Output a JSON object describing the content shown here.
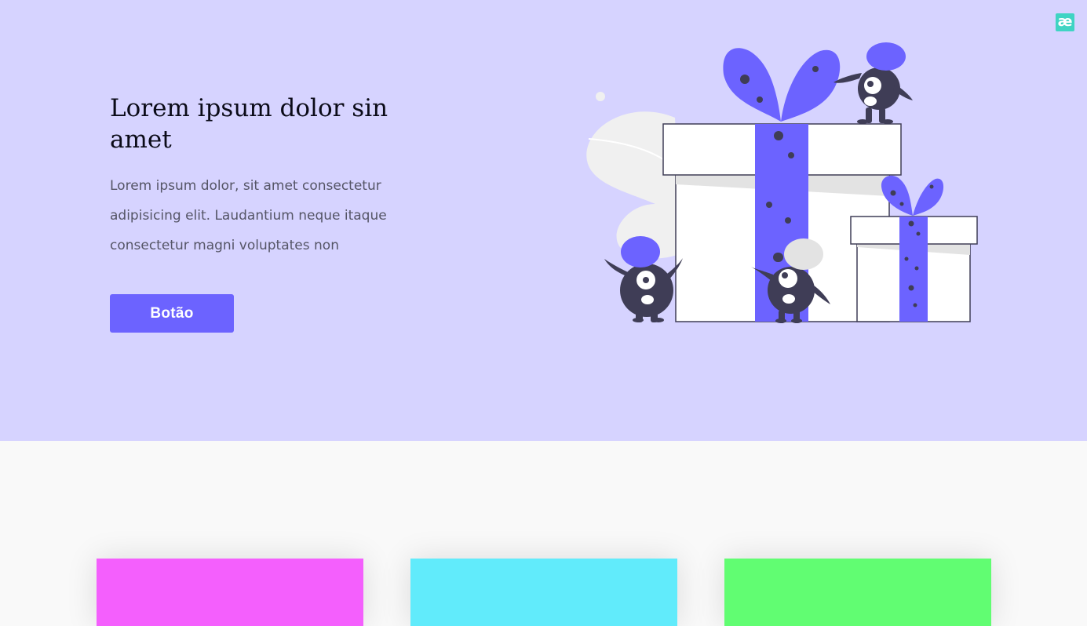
{
  "hero": {
    "title": "Lorem ipsum dolor sin amet",
    "body": "Lorem ipsum dolor, sit amet consectetur adipisicing elit. Laudantium neque itaque consectetur magni voluptates non",
    "button_label": "Botão",
    "illustration_icon": "gift-boxes-with-monsters-illustration",
    "colors": {
      "background": "#d6d3ff",
      "accent": "#6c63ff",
      "dark": "#2f2e41"
    }
  },
  "logo": {
    "glyph": "æ",
    "icon": "brand-logo-icon",
    "color": "#3fd4c3"
  },
  "cards": [
    {
      "color": "#f45ffd"
    },
    {
      "color": "#61ebfb"
    },
    {
      "color": "#61fd72"
    }
  ]
}
